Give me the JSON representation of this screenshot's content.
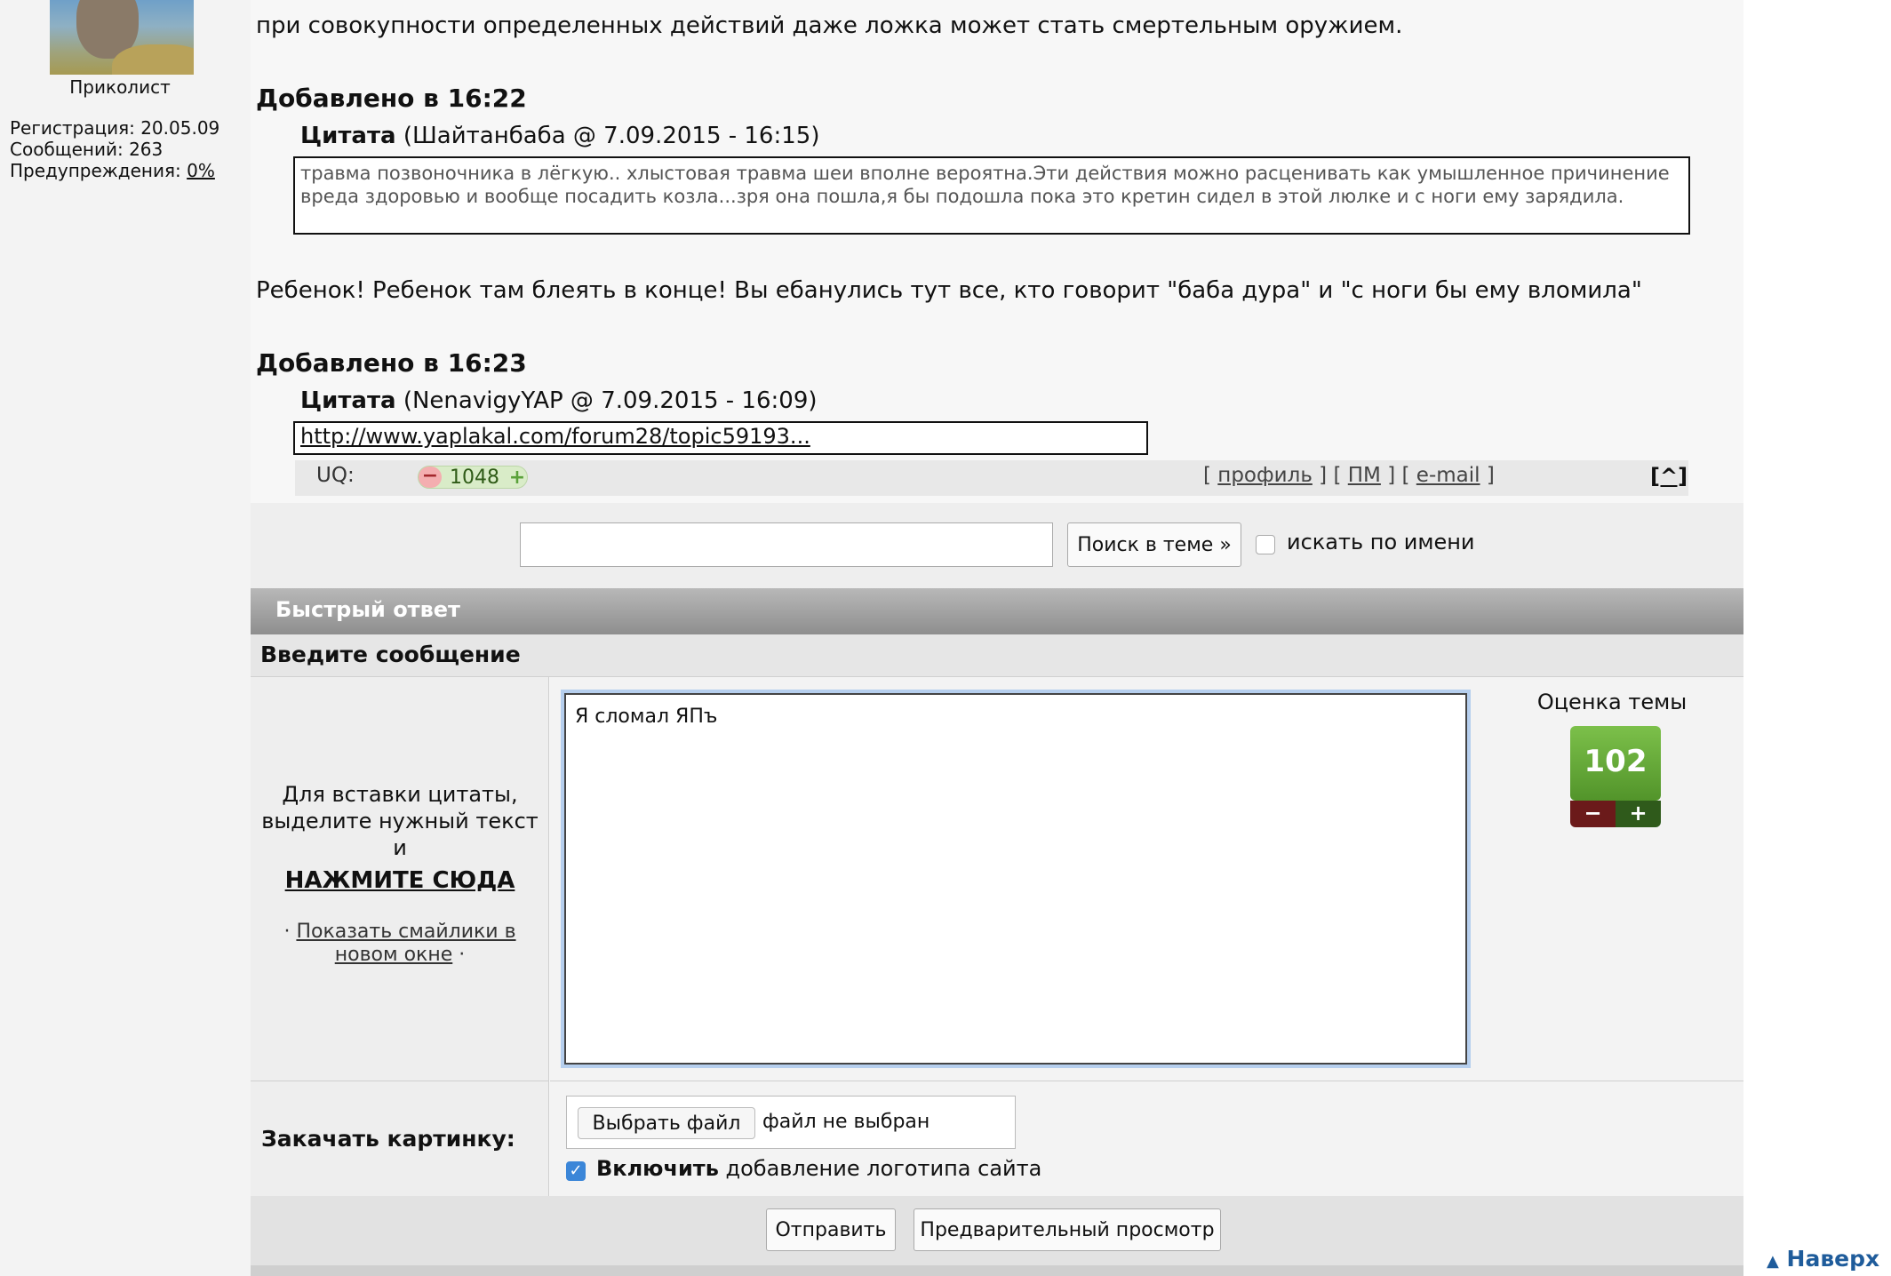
{
  "user": {
    "name": "Приколист",
    "registration": "Регистрация: 20.05.09",
    "messages": "Сообщений: 263",
    "warnings_label": "Предупреждения: ",
    "warnings_value": "0%"
  },
  "post": {
    "intro_text": "при совокупности определенных действий даже ложка может стать смертельным оружием.",
    "added1": "Добавлено в 16:22",
    "quote1_label": "Цитата",
    "quote1_meta": " (Шайтанбаба @ 7.09.2015 - 16:15)",
    "quote1_text": "травма позвоночника в лёгкую.. хлыстовая травма шеи вполне вероятна.Эти действия можно расценивать как умышленное причинение вреда здоровью и вообще посадить козла...зря она пошла,я бы подошла пока это кретин сидел в этой люлке и с ноги ему зарядила.",
    "reply_text": "Ребенок! Ребенок там блеять в конце! Вы ебанулись тут все, кто говорит \"баба дура\" и \"с ноги бы ему вломила\"",
    "added2": "Добавлено в 16:23",
    "quote2_label": "Цитата",
    "quote2_meta": " (NenavigyYAP @ 7.09.2015 - 16:09)",
    "quote2_link": "http://www.yaplakal.com/forum28/topic59193..."
  },
  "post_footer": {
    "uq_label": "UQ:",
    "uq_minus": "−",
    "uq_value": "1048",
    "uq_plus": "+",
    "bracket_open": "[ ",
    "profile": "профиль",
    "sep1": " ] [ ",
    "pm": "ПМ",
    "sep2": " ] [ ",
    "email": "e-mail",
    "bracket_close": " ]",
    "to_top_small": "[^]"
  },
  "search": {
    "input_value": "",
    "button": "Поиск в теме »",
    "by_name_label": "искать по имени"
  },
  "quick_reply": {
    "title": "Быстрый ответ",
    "subtitle": "Введите сообщение",
    "hint_line1": "Для вставки цитаты,",
    "hint_line2": "выделите нужный текст",
    "hint_line3": "и",
    "click_here": "НАЖМИТЕ СЮДА",
    "smiles_prefix": "· ",
    "smiles_link1": "Показать смайлики в",
    "smiles_link2": "новом окне",
    "smiles_suffix": " ·",
    "message_value": "Я сломал ЯПъ",
    "rating_label": "Оценка темы",
    "rating_value": "102",
    "rating_minus": "−",
    "rating_plus": "+"
  },
  "upload": {
    "label": "Закачать картинку:",
    "choose_button": "Выбрать файл",
    "file_status": "файл не выбран",
    "logo_bold": "Включить",
    "logo_rest": " добавление логотипа сайта",
    "logo_checked_mark": "✓"
  },
  "actions": {
    "send": "Отправить",
    "preview": "Предварительный просмотр"
  },
  "page": {
    "to_top_arrow": "▲",
    "to_top": " Наверх"
  }
}
